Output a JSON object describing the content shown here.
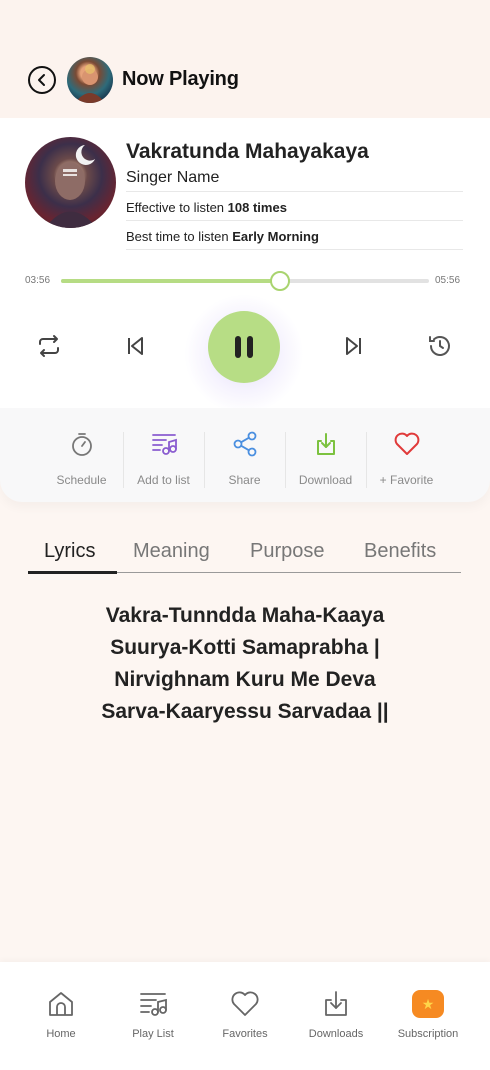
{
  "header": {
    "title": "Now Playing",
    "back_icon": "back-arrow-icon",
    "avatar": "deity-avatar"
  },
  "track": {
    "title": "Vakratunda Mahayakaya",
    "singer": "Singer Name",
    "listen_prefix": "Effective to listen",
    "listen_value": "108 times",
    "time_prefix": "Best time to listen",
    "time_value": "Early Morning",
    "elapsed": "03:56",
    "duration": "05:56",
    "progress_fraction": 0.594
  },
  "controls": {
    "repeat_icon": "repeat-icon",
    "previous_icon": "skip-previous-icon",
    "pause_icon": "pause-icon",
    "next_icon": "skip-next-icon",
    "timer_icon": "timer-icon",
    "accent_color": "#b7dd85"
  },
  "actions": [
    {
      "label": "Schedule",
      "icon": "stopwatch-icon",
      "color": "#777777"
    },
    {
      "label": "Add to list",
      "icon": "playlist-add-icon",
      "color": "#8a5cd0"
    },
    {
      "label": "Share",
      "icon": "share-icon",
      "color": "#4a8fe0"
    },
    {
      "label": "Download",
      "icon": "download-icon",
      "color": "#7cc240"
    },
    {
      "label": "+ Favorite",
      "icon": "heart-icon",
      "color": "#e03a3a"
    }
  ],
  "tabs": [
    {
      "label": "Lyrics",
      "active": true
    },
    {
      "label": "Meaning",
      "active": false
    },
    {
      "label": "Purpose",
      "active": false
    },
    {
      "label": "Benefits",
      "active": false
    }
  ],
  "lyrics": [
    "Vakra-Tunndda Maha-Kaaya",
    "Suurya-Kotti Samaprabha |",
    "Nirvighnam Kuru Me Deva",
    "Sarva-Kaaryessu Sarvadaa ||"
  ],
  "bottom_nav": [
    {
      "label": "Home",
      "icon": "home-icon"
    },
    {
      "label": "Play List",
      "icon": "playlist-icon"
    },
    {
      "label": "Favorites",
      "icon": "heart-outline-icon"
    },
    {
      "label": "Downloads",
      "icon": "download-tray-icon"
    },
    {
      "label": "Subscription",
      "icon": "star-badge-icon"
    }
  ]
}
